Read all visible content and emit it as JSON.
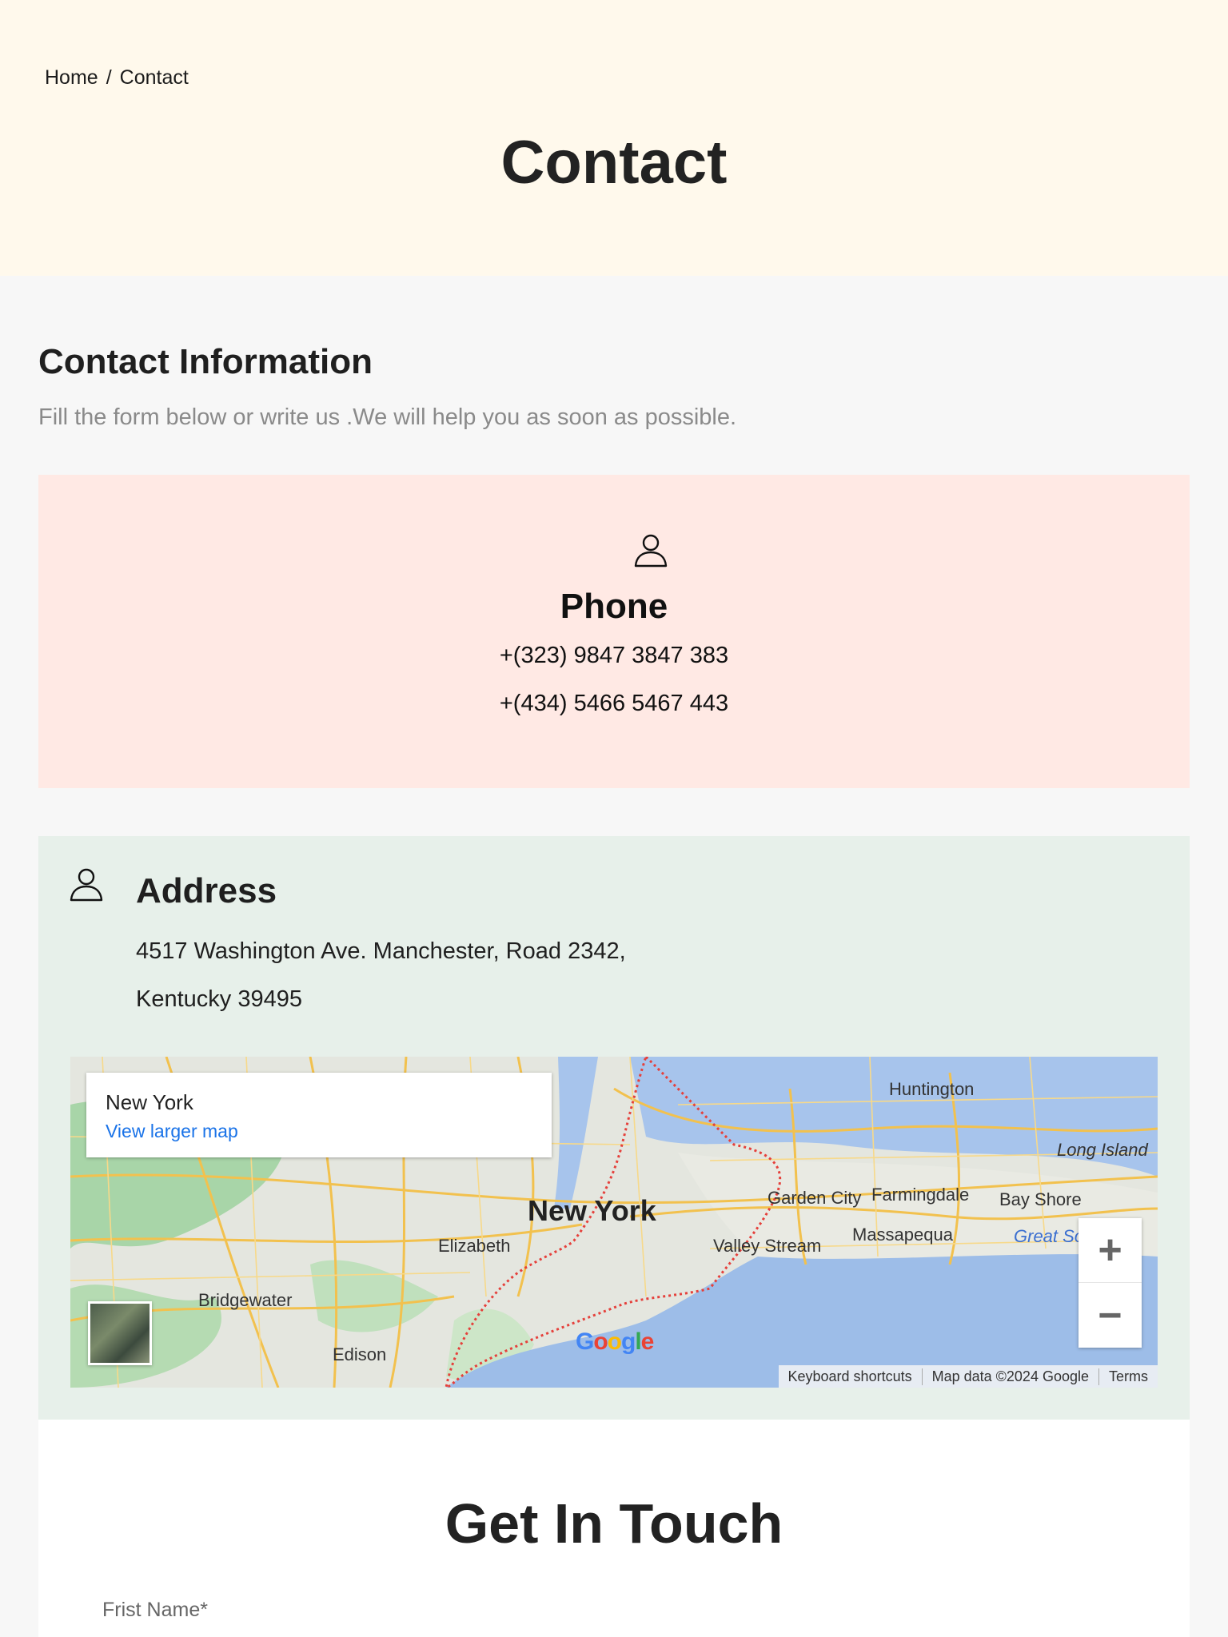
{
  "breadcrumb": {
    "home": "Home",
    "separator": "/",
    "current": "Contact"
  },
  "hero": {
    "title": "Contact"
  },
  "contact_info": {
    "title": "Contact Information",
    "subtitle": "Fill the form below or write us .We will help you as soon as possible."
  },
  "phone_card": {
    "icon": "user-icon",
    "title": "Phone",
    "numbers": [
      "+(323) 9847 3847 383",
      "+(434) 5466 5467 443"
    ]
  },
  "address_card": {
    "icon": "user-icon",
    "title": "Address",
    "lines": [
      "4517 Washington Ave. Manchester, Road 2342,",
      "Kentucky 39495"
    ]
  },
  "map": {
    "place_name": "New York",
    "larger_map_link": "View larger map",
    "labels": {
      "new_york": "New York",
      "huntington": "Huntington",
      "long_island": "Long Island",
      "garden_city": "Garden City",
      "farmingdale": "Farmingdale",
      "bay_shore": "Bay Shore",
      "massapequa": "Massapequa",
      "valley_stream": "Valley Stream",
      "elizabeth": "Elizabeth",
      "bridgewater": "Bridgewater",
      "edison": "Edison",
      "great_south": "Great So"
    },
    "zoom_in": "+",
    "zoom_out": "−",
    "google_logo": "Google",
    "footer": {
      "shortcuts": "Keyboard shortcuts",
      "data": "Map data ©2024 Google",
      "terms": "Terms"
    }
  },
  "get_in_touch": {
    "title": "Get In Touch",
    "first_name_label": "Frist Name*"
  },
  "colors": {
    "hero_bg": "#fff9ec",
    "phone_card_bg": "#ffe9e4",
    "address_card_bg": "#e7f0ea",
    "link_blue": "#1a73e8"
  }
}
